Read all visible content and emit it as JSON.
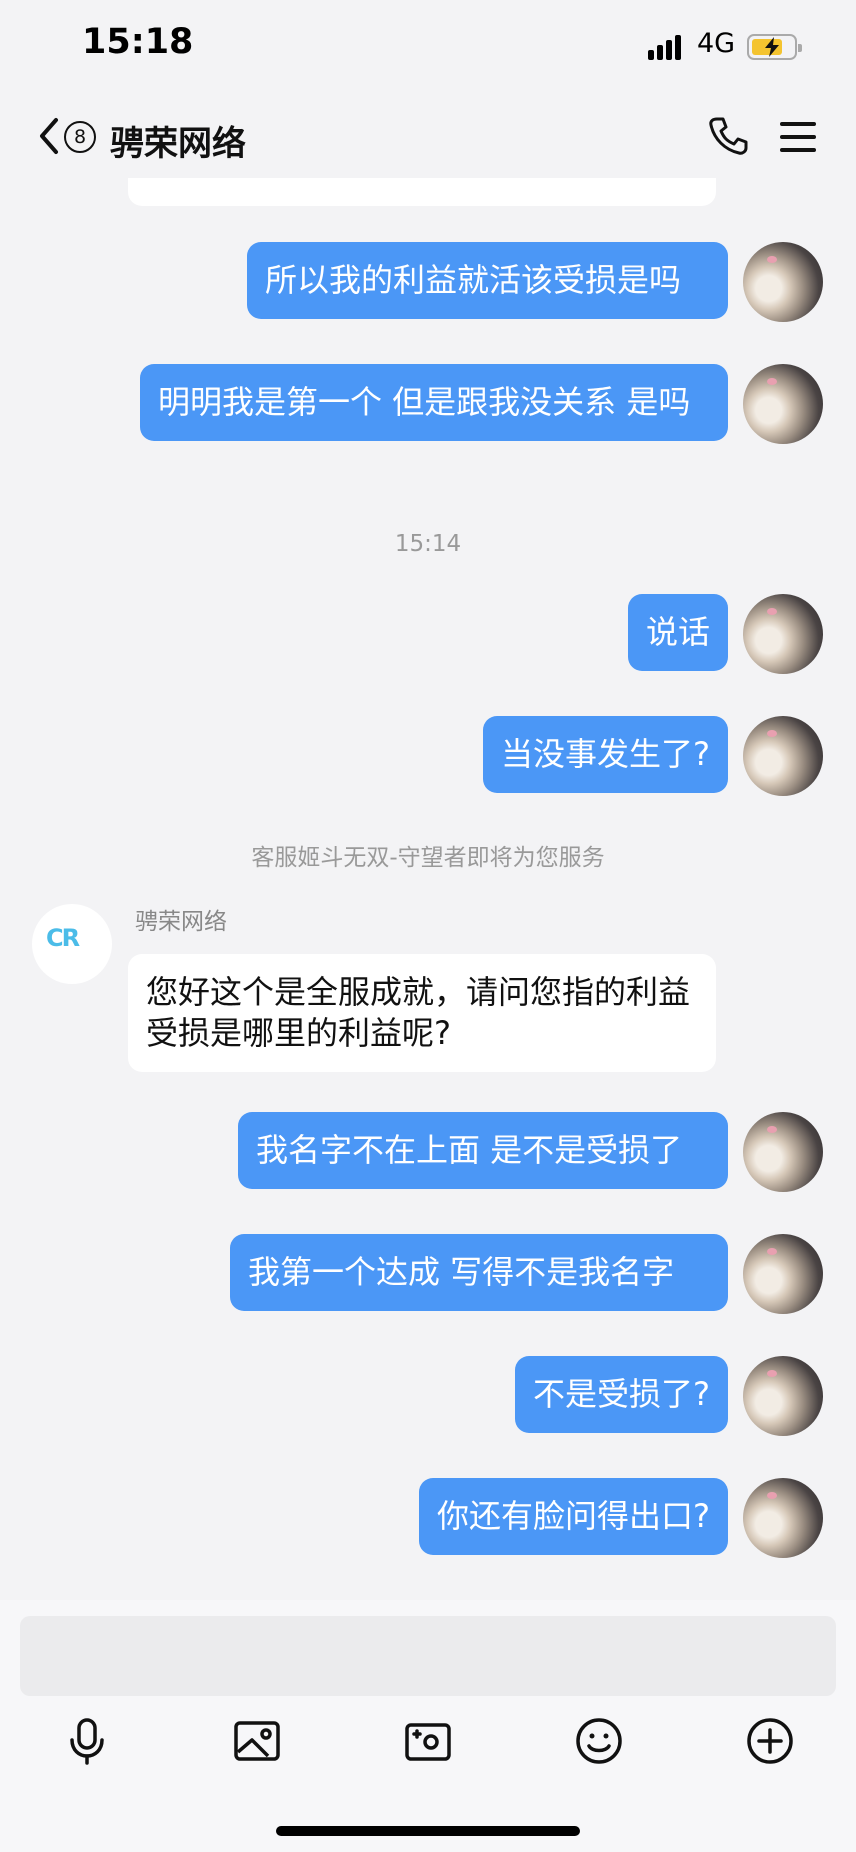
{
  "status_bar": {
    "time": "15:18",
    "network": "4G"
  },
  "header": {
    "unread_count": "8",
    "title": "骋荣网络"
  },
  "messages": {
    "partial_top": "…",
    "out_1": "所以我的利益就活该受损是吗",
    "out_2": "明明我是第一个  但是跟我没关系  是吗",
    "timestamp_1": "15:14",
    "out_3": "说话",
    "out_4": "当没事发生了?",
    "system_note": "客服姬斗无双-守望者即将为您服务",
    "agent_name": "骋荣网络",
    "agent_logo": "CR",
    "agent_logo_text": "骋荣网络",
    "in_1": "您好这个是全服成就，请问您指的利益受损是哪里的利益呢?",
    "out_5": "我名字不在上面 是不是受损了",
    "out_6": "我第一个达成  写得不是我名字",
    "out_7": "不是受损了?",
    "out_8": "你还有脸问得出口?"
  },
  "input": {
    "placeholder": ""
  },
  "toolbar": {
    "icons": [
      "microphone-icon",
      "image-icon",
      "camera-icon",
      "emoji-icon",
      "plus-icon"
    ]
  },
  "colors": {
    "outgoing_bubble": "#4b97f6",
    "incoming_bubble": "#ffffff",
    "background": "#f3f3f5"
  }
}
